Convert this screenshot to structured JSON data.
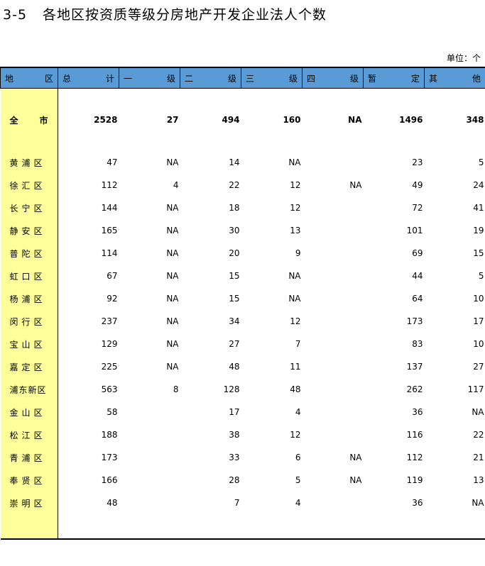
{
  "title": {
    "number": "3-5",
    "text": "各地区按资质等级分房地产开发企业法人个数"
  },
  "unit_label": "单位：个",
  "headers": [
    {
      "a": "地",
      "b": "区"
    },
    {
      "a": "总",
      "b": "计"
    },
    {
      "a": "一",
      "b": "级"
    },
    {
      "a": "二",
      "b": "级"
    },
    {
      "a": "三",
      "b": "级"
    },
    {
      "a": "四",
      "b": "级"
    },
    {
      "a": "暂",
      "b": "定"
    },
    {
      "a": "其",
      "b": "他"
    }
  ],
  "total_row": {
    "name": "全市",
    "values": [
      "2528",
      "27",
      "494",
      "160",
      "NA",
      "1496",
      "348"
    ]
  },
  "rows": [
    {
      "name": "黄浦区",
      "values": [
        "47",
        "NA",
        "14",
        "NA",
        "",
        "23",
        "5"
      ]
    },
    {
      "name": "徐汇区",
      "values": [
        "112",
        "4",
        "22",
        "12",
        "NA",
        "49",
        "24"
      ]
    },
    {
      "name": "长宁区",
      "values": [
        "144",
        "NA",
        "18",
        "12",
        "",
        "72",
        "41"
      ]
    },
    {
      "name": "静安区",
      "values": [
        "165",
        "NA",
        "30",
        "13",
        "",
        "101",
        "19"
      ]
    },
    {
      "name": "普陀区",
      "values": [
        "114",
        "NA",
        "20",
        "9",
        "",
        "69",
        "15"
      ]
    },
    {
      "name": "虹口区",
      "values": [
        "67",
        "NA",
        "15",
        "NA",
        "",
        "44",
        "5"
      ]
    },
    {
      "name": "杨浦区",
      "values": [
        "92",
        "NA",
        "15",
        "NA",
        "",
        "64",
        "10"
      ]
    },
    {
      "name": "闵行区",
      "values": [
        "237",
        "NA",
        "34",
        "12",
        "",
        "173",
        "17"
      ]
    },
    {
      "name": "宝山区",
      "values": [
        "129",
        "NA",
        "27",
        "7",
        "",
        "83",
        "10"
      ]
    },
    {
      "name": "嘉定区",
      "values": [
        "225",
        "NA",
        "48",
        "11",
        "",
        "137",
        "27"
      ]
    },
    {
      "name": "浦东新区",
      "values": [
        "563",
        "8",
        "128",
        "48",
        "",
        "262",
        "117"
      ]
    },
    {
      "name": "金山区",
      "values": [
        "58",
        "",
        "17",
        "4",
        "",
        "36",
        "NA"
      ]
    },
    {
      "name": "松江区",
      "values": [
        "188",
        "",
        "38",
        "12",
        "",
        "116",
        "22"
      ]
    },
    {
      "name": "青浦区",
      "values": [
        "173",
        "",
        "33",
        "6",
        "NA",
        "112",
        "21"
      ]
    },
    {
      "name": "奉贤区",
      "values": [
        "166",
        "",
        "28",
        "5",
        "NA",
        "119",
        "13"
      ]
    },
    {
      "name": "崇明区",
      "values": [
        "48",
        "",
        "7",
        "4",
        "",
        "36",
        "NA"
      ]
    }
  ]
}
